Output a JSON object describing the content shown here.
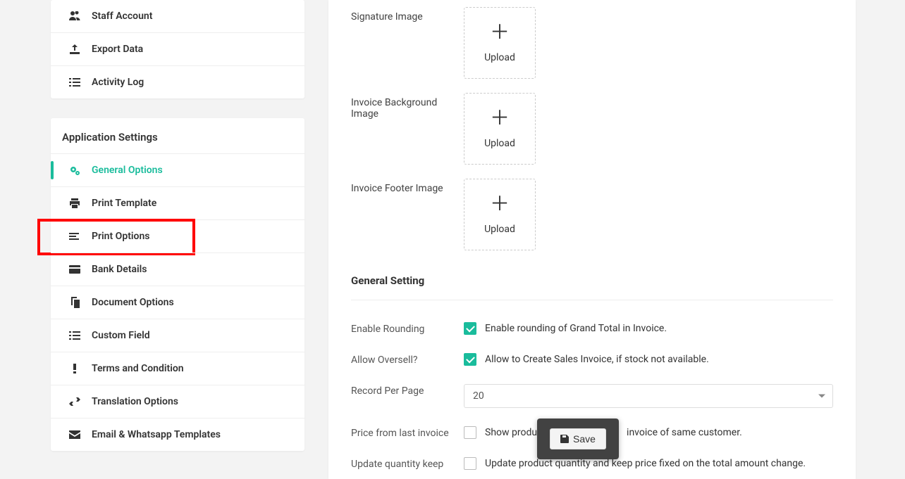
{
  "sidebar": {
    "group1": [
      {
        "label": "Staff Account",
        "icon": "users-icon"
      },
      {
        "label": "Export Data",
        "icon": "upload-icon"
      },
      {
        "label": "Activity Log",
        "icon": "list-icon"
      }
    ],
    "app_settings_title": "Application Settings",
    "group2": [
      {
        "label": "General Options",
        "icon": "gears-icon",
        "active": true
      },
      {
        "label": "Print Template",
        "icon": "print-icon"
      },
      {
        "label": "Print Options",
        "icon": "lines-icon",
        "highlight": true
      },
      {
        "label": "Bank Details",
        "icon": "card-icon"
      },
      {
        "label": "Document Options",
        "icon": "copy-icon"
      },
      {
        "label": "Custom Field",
        "icon": "list-icon"
      },
      {
        "label": "Terms and Condition",
        "icon": "exclaim-icon"
      },
      {
        "label": "Translation Options",
        "icon": "swap-icon"
      },
      {
        "label": "Email & Whatsapp Templates",
        "icon": "envelope-icon"
      }
    ]
  },
  "uploads": {
    "signature_label": "Signature Image",
    "bg_label": "Invoice Background Image",
    "footer_label": "Invoice Footer Image",
    "upload_text": "Upload"
  },
  "general": {
    "heading": "General Setting",
    "rounding_label": "Enable Rounding",
    "rounding_desc": "Enable rounding of Grand Total in Invoice.",
    "oversell_label": "Allow Oversell?",
    "oversell_desc": "Allow to Create Sales Invoice, if stock not available.",
    "perpage_label": "Record Per Page",
    "perpage_value": "20",
    "lastprice_label": "Price from last invoice",
    "lastprice_desc_a": "Show produ",
    "lastprice_desc_b": "invoice of same customer.",
    "updateqty_label": "Update quantity keep",
    "updateqty_desc": "Update product quantity and keep price fixed on the total amount change."
  },
  "save": {
    "label": "Save"
  }
}
